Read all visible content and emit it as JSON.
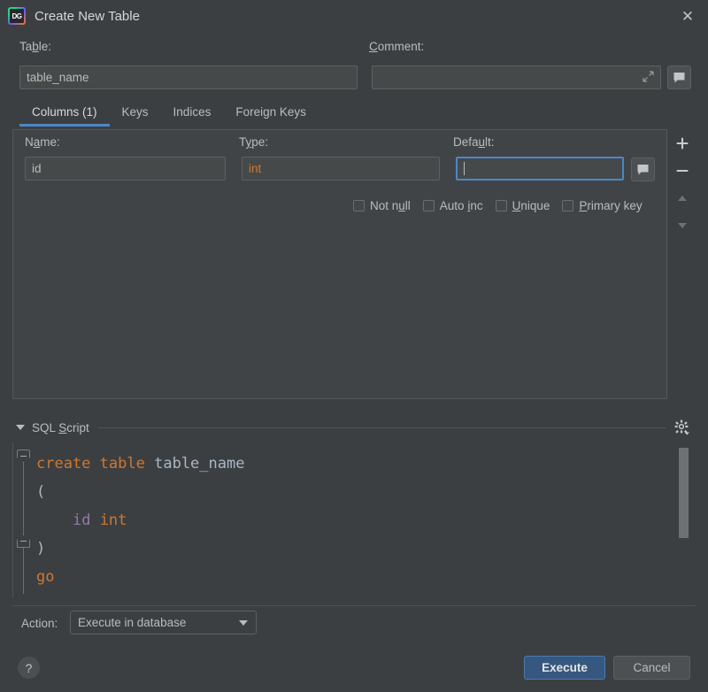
{
  "window": {
    "title": "Create New Table",
    "app_icon": "datagrip-logo-icon",
    "close_icon": "close-icon"
  },
  "form": {
    "table_label": "Table:",
    "table_value": "table_name",
    "comment_label": "Comment:",
    "comment_value": "",
    "comment_expand_icon": "expand-icon",
    "comment_button_icon": "comment-bubble-icon"
  },
  "tabs": [
    {
      "label": "Columns (1)",
      "active": true
    },
    {
      "label": "Keys",
      "active": false
    },
    {
      "label": "Indices",
      "active": false
    },
    {
      "label": "Foreign Keys",
      "active": false
    }
  ],
  "column_editor": {
    "name_label": "Name:",
    "name_value": "id",
    "type_label": "Type:",
    "type_value": "int",
    "default_label": "Default:",
    "default_value": "",
    "default_button_icon": "comment-bubble-icon",
    "checkboxes": [
      {
        "label": "Not null",
        "checked": false
      },
      {
        "label": "Auto inc",
        "checked": false
      },
      {
        "label": "Unique",
        "checked": false
      },
      {
        "label": "Primary key",
        "checked": false
      }
    ],
    "toolbar": [
      {
        "icon": "plus-icon",
        "enabled": true
      },
      {
        "icon": "minus-icon",
        "enabled": true
      },
      {
        "icon": "arrow-up-icon",
        "enabled": false
      },
      {
        "icon": "arrow-down-icon",
        "enabled": false
      }
    ]
  },
  "sql_section": {
    "title": "SQL Script",
    "collapse_icon": "triangle-down-icon",
    "settings_icon": "gear-icon",
    "code_lines": [
      {
        "tokens": [
          {
            "t": "create",
            "c": "kw"
          },
          {
            "t": " ",
            "c": "ide"
          },
          {
            "t": "table",
            "c": "kw"
          },
          {
            "t": " ",
            "c": "ide"
          },
          {
            "t": "table_name",
            "c": "ide"
          }
        ]
      },
      {
        "tokens": [
          {
            "t": "(",
            "c": "par"
          }
        ]
      },
      {
        "tokens": [
          {
            "t": "    ",
            "c": "ide"
          },
          {
            "t": "id",
            "c": "col"
          },
          {
            "t": " ",
            "c": "ide"
          },
          {
            "t": "int",
            "c": "kw"
          }
        ]
      },
      {
        "tokens": [
          {
            "t": ")",
            "c": "par"
          }
        ]
      },
      {
        "tokens": [
          {
            "t": "go",
            "c": "kw"
          }
        ]
      }
    ]
  },
  "footer": {
    "action_label": "Action:",
    "action_value": "Execute in database",
    "help_label": "?",
    "execute_label": "Execute",
    "cancel_label": "Cancel"
  },
  "colors": {
    "dialog_bg": "#3c3f41",
    "panel_bg": "#414447",
    "field_bg": "#45494a",
    "accent": "#4a88c7",
    "primary_button": "#365880",
    "keyword": "#cc7832",
    "identifier": "#a9b7c6",
    "column_name": "#9876aa"
  }
}
